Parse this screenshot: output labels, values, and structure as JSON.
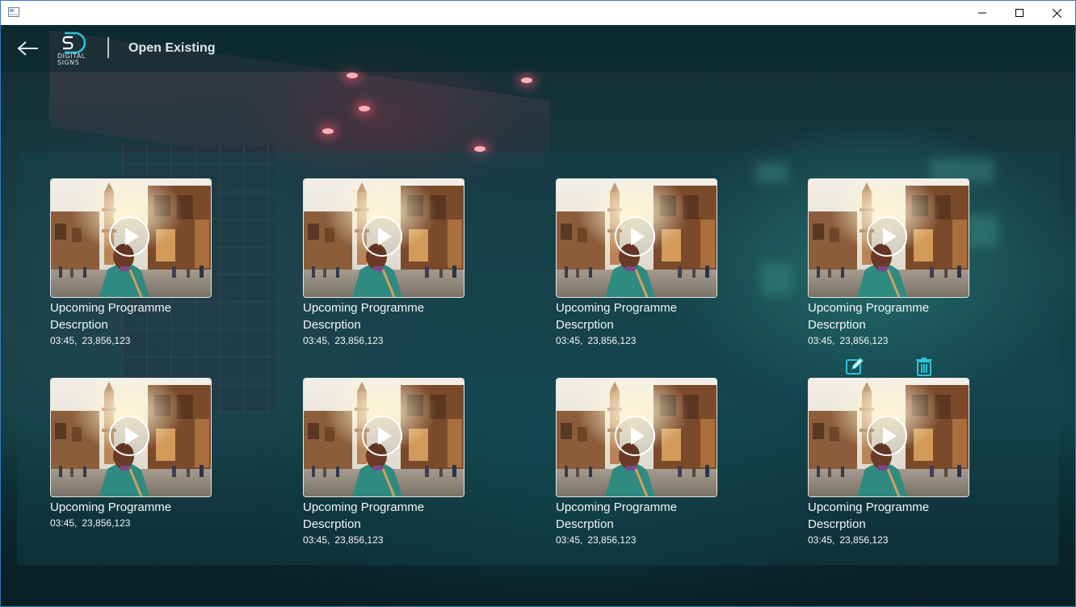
{
  "window": {
    "title": "",
    "controls": {
      "minimize": "minimize-icon",
      "maximize": "maximize-icon",
      "close": "close-icon"
    }
  },
  "header": {
    "back_icon": "back-arrow-icon",
    "logo": {
      "letters": "SD",
      "caption_line1": "DIGITAL",
      "caption_line2": "SIGNS"
    },
    "title": "Open Existing"
  },
  "colors": {
    "accent": "#2fc4d8",
    "text": "#f2f6f7",
    "header_bg": "#0b2a30"
  },
  "grid": {
    "rows": [
      {
        "cards": [
          {
            "title": "Upcoming Programme",
            "description": "Descrption",
            "duration": "03:45,",
            "views": "23,856,123"
          },
          {
            "title": "Upcoming Programme",
            "description": "Descrption",
            "duration": "03:45,",
            "views": "23,856,123"
          },
          {
            "title": "Upcoming Programme",
            "description": "Descrption",
            "duration": "03:45,",
            "views": "23,856,123"
          },
          {
            "title": "Upcoming Programme",
            "description": "Descrption",
            "duration": "03:45,",
            "views": "23,856,123"
          }
        ]
      },
      {
        "cards": [
          {
            "title": "Upcoming Programme",
            "description": "",
            "duration": "03:45,",
            "views": "23,856,123"
          },
          {
            "title": "Upcoming Programme",
            "description": "Descrption",
            "duration": "03:45,",
            "views": "23,856,123"
          },
          {
            "title": "Upcoming Programme",
            "description": "Descrption",
            "duration": "03:45,",
            "views": "23,856,123"
          },
          {
            "title": "Upcoming Programme",
            "description": "Descrption",
            "duration": "03:45,",
            "views": "23,856,123"
          }
        ]
      }
    ],
    "hover_actions": {
      "edit_icon": "edit-pencil-icon",
      "delete_icon": "trash-icon"
    }
  }
}
